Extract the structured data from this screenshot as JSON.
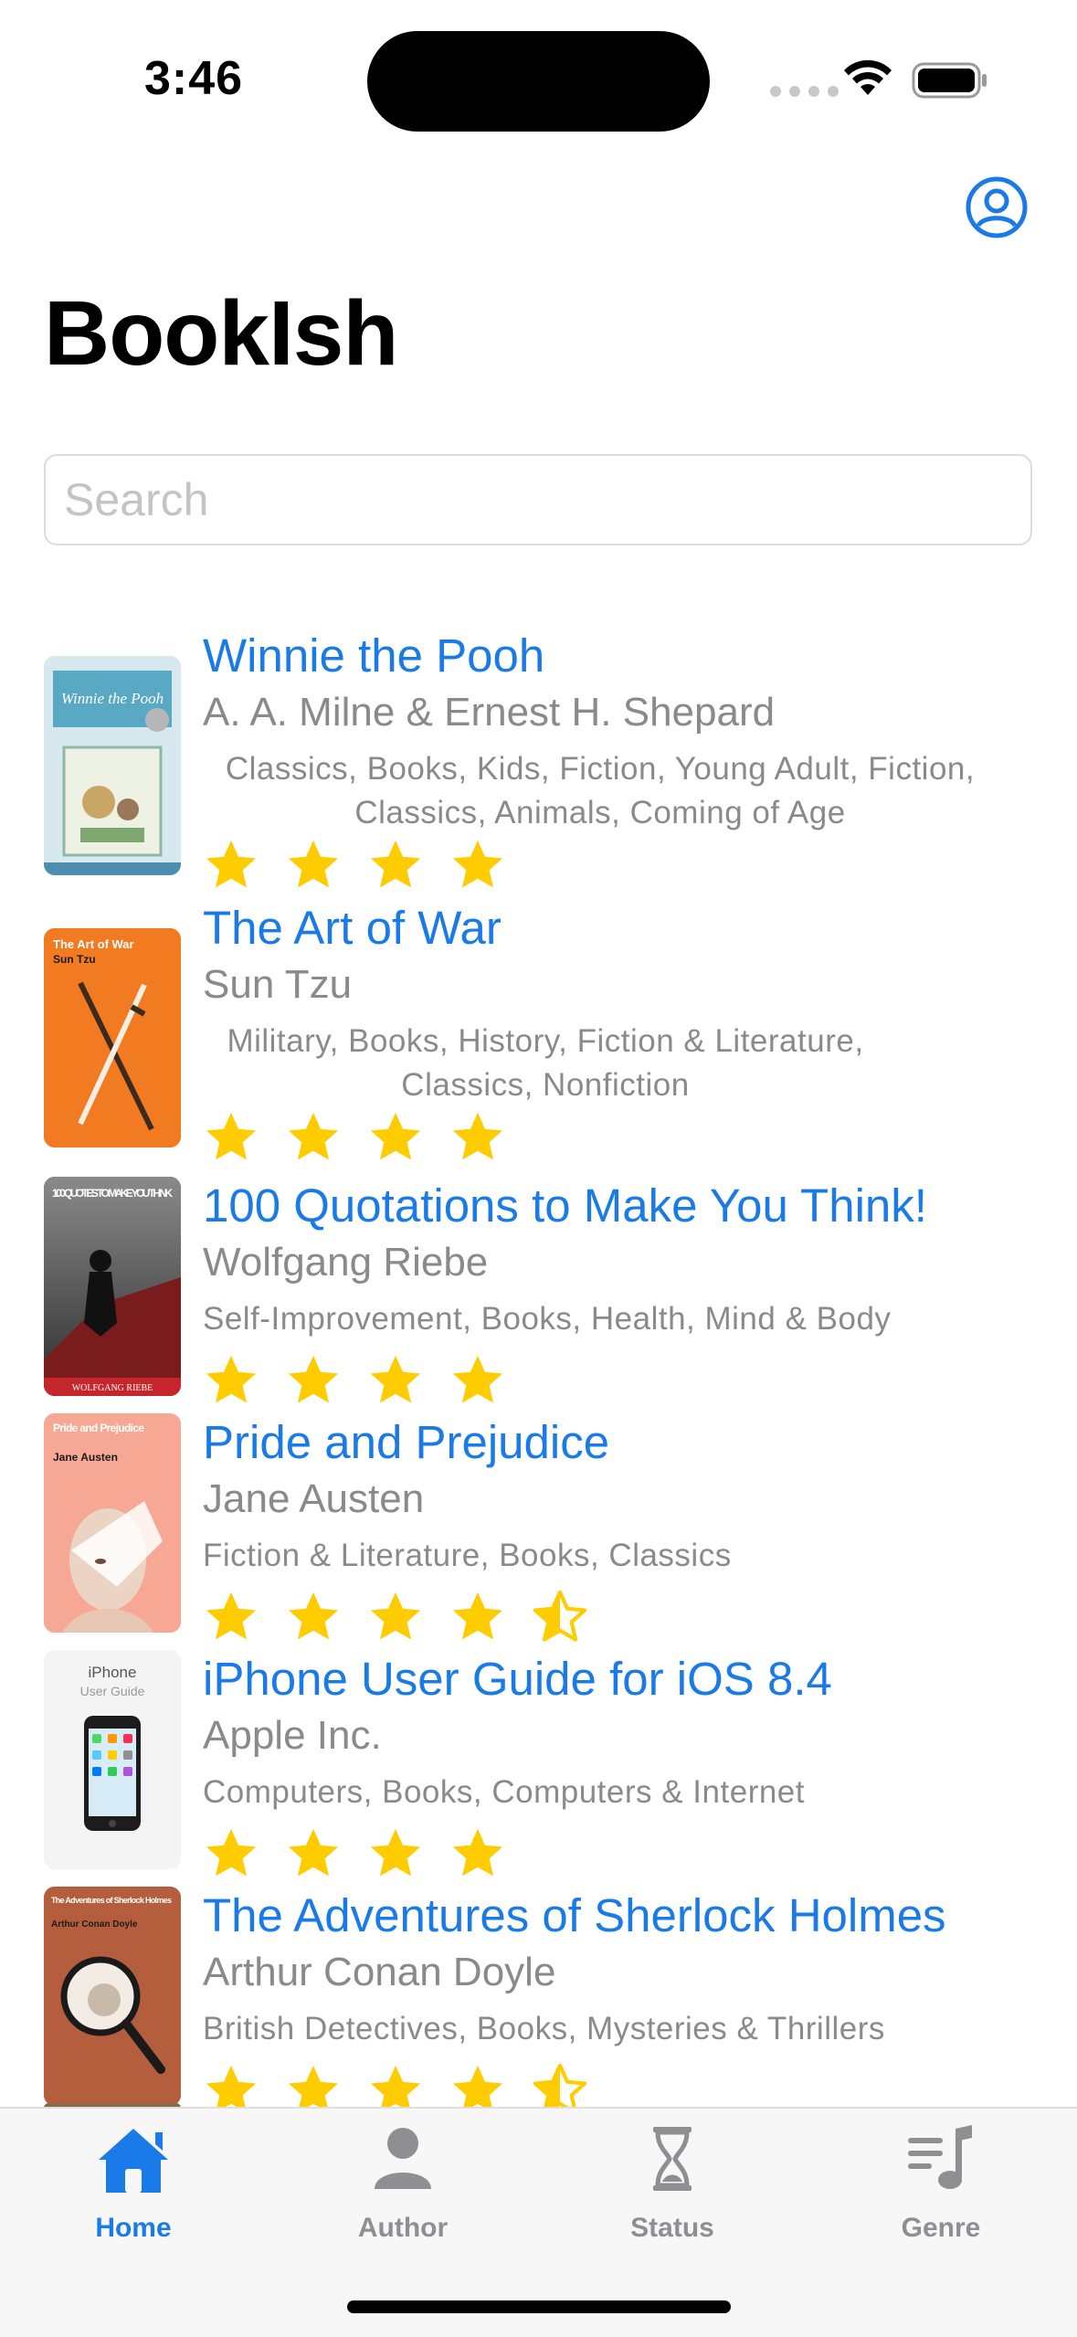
{
  "status_bar": {
    "time": "3:46"
  },
  "header": {
    "title": "BookIsh"
  },
  "search": {
    "placeholder": "Search",
    "value": ""
  },
  "books": [
    {
      "title": "Winnie the Pooh",
      "author": "A. A. Milne & Ernest H. Shepard",
      "genres": "Classics, Books, Kids, Fiction, Young Adult, Fiction, Classics, Animals, Coming of Age",
      "rating": 4,
      "cover_text": "Winnie the Pooh"
    },
    {
      "title": "The Art of War",
      "author": "Sun Tzu",
      "genres": "Military, Books, History, Fiction & Literature, Classics, Nonfiction",
      "rating": 4,
      "cover_text": "The Art of War",
      "cover_subtext": "Sun Tzu"
    },
    {
      "title": "100 Quotations to Make You Think!",
      "author": "Wolfgang Riebe",
      "genres": "Self-Improvement, Books, Health, Mind & Body",
      "rating": 4,
      "cover_text": "100 QUOTES TO MAKE YOU THINK",
      "cover_subtext": "WOLFGANG RIEBE"
    },
    {
      "title": "Pride and Prejudice",
      "author": "Jane Austen",
      "genres": "Fiction & Literature, Books, Classics",
      "rating": 4.5,
      "cover_text": "Pride and Prejudice",
      "cover_subtext": "Jane Austen"
    },
    {
      "title": "iPhone User Guide for iOS 8.4",
      "author": "Apple Inc.",
      "genres": "Computers, Books, Computers & Internet",
      "rating": 4,
      "cover_text": "iPhone",
      "cover_subtext": "User Guide"
    },
    {
      "title": "The Adventures of Sherlock Holmes",
      "author": "Arthur Conan Doyle",
      "genres": "British Detectives, Books, Mysteries & Thrillers",
      "rating": 4.5,
      "cover_text": "The Adventures of Sherlock Holmes",
      "cover_subtext": "Arthur Conan Doyle"
    }
  ],
  "tabs": [
    {
      "label": "Home",
      "icon": "house-icon",
      "active": true
    },
    {
      "label": "Author",
      "icon": "person-icon",
      "active": false
    },
    {
      "label": "Status",
      "icon": "hourglass-icon",
      "active": false
    },
    {
      "label": "Genre",
      "icon": "music-list-icon",
      "active": false
    }
  ],
  "colors": {
    "accent": "#1a7ae8",
    "star": "#ffcc00",
    "secondary_text": "#8a8a8e",
    "tab_inactive": "#8e8e93"
  }
}
